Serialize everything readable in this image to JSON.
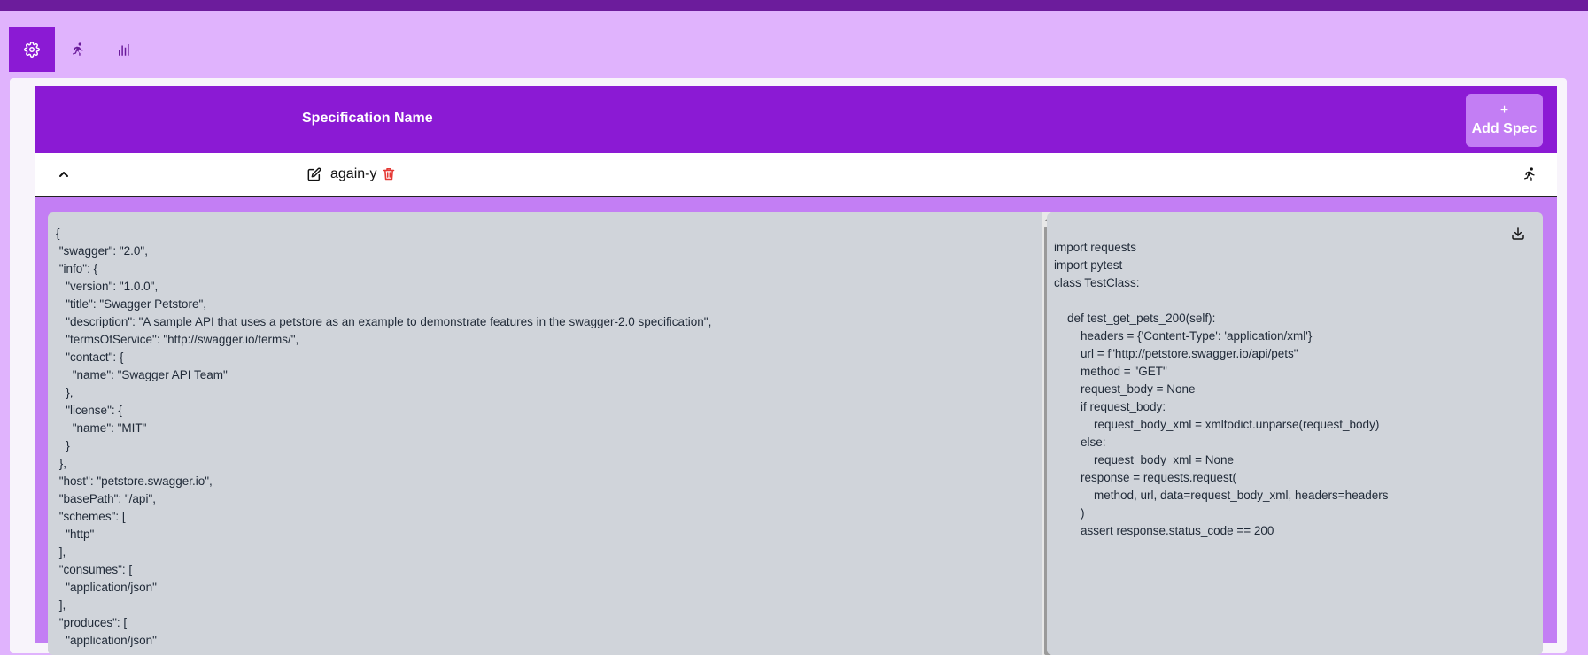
{
  "toolbar": {
    "items": [
      {
        "icon": "gear-icon",
        "active": true
      },
      {
        "icon": "runner-icon",
        "active": false
      },
      {
        "icon": "bar-chart-icon",
        "active": false
      }
    ]
  },
  "table": {
    "column_title": "Specification Name",
    "add_button": {
      "plus": "+",
      "label": "Add Spec"
    }
  },
  "row": {
    "name": "again-y",
    "icons": [
      "chevron-up-icon",
      "edit-icon",
      "trash-icon",
      "runner-icon"
    ],
    "trash_color": "#e53935"
  },
  "spec_json": "{\n \"swagger\": \"2.0\",\n \"info\": {\n   \"version\": \"1.0.0\",\n   \"title\": \"Swagger Petstore\",\n   \"description\": \"A sample API that uses a petstore as an example to demonstrate features in the swagger-2.0 specification\",\n   \"termsOfService\": \"http://swagger.io/terms/\",\n   \"contact\": {\n     \"name\": \"Swagger API Team\"\n   },\n   \"license\": {\n     \"name\": \"MIT\"\n   }\n },\n \"host\": \"petstore.swagger.io\",\n \"basePath\": \"/api\",\n \"schemes\": [\n   \"http\"\n ],\n \"consumes\": [\n   \"application/json\"\n ],\n \"produces\": [\n   \"application/json\"",
  "generated_code": "import requests\nimport pytest\nclass TestClass:\n\n    def test_get_pets_200(self):\n        headers = {'Content-Type': 'application/xml'}\n        url = f\"http://petstore.swagger.io/api/pets\"\n        method = \"GET\"\n        request_body = None\n        if request_body:\n            request_body_xml = xmltodict.unparse(request_body)\n        else:\n            request_body_xml = None\n        response = requests.request(\n            method, url, data=request_body_xml, headers=headers\n        )\n        assert response.status_code == 200",
  "colors": {
    "accent": "#8b1ad4",
    "page_bg": "#e0b3fd",
    "topbar": "#6c1c9c",
    "button": "#c37ef4",
    "code_bg": "#d0d4da"
  }
}
